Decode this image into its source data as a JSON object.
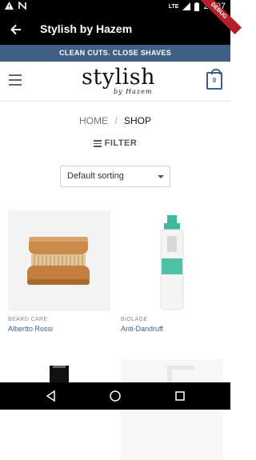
{
  "status_bar": {
    "network_label": "LTE",
    "time": "23:07",
    "ribbon": "DEBUG"
  },
  "app_bar": {
    "title": "Stylish by Hazem"
  },
  "promo": {
    "text": "CLEAN CUTS. CLOSE SHAVES"
  },
  "header": {
    "logo_main": "stylish",
    "logo_sub": "by Hazem",
    "cart_count": "0"
  },
  "breadcrumb": {
    "home": "HOME",
    "separator": "/",
    "current": "SHOP"
  },
  "filter": {
    "label": "FILTER"
  },
  "sort": {
    "selected": "Default sorting"
  },
  "products": [
    {
      "category": "BEARD CARE",
      "name": "Albertto Rossi"
    },
    {
      "category": "BIOLAGE",
      "name": "Anti-Dandruff"
    }
  ],
  "colors": {
    "accent": "#3f5f84",
    "bar": "#000000",
    "ribbon": "#b4202a"
  }
}
